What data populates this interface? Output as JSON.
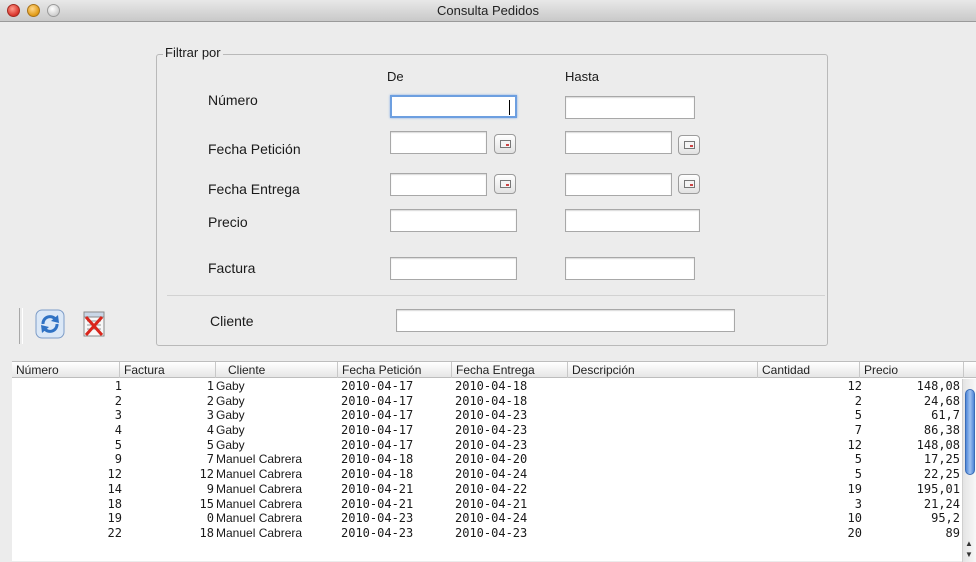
{
  "window": {
    "title": "Consulta Pedidos"
  },
  "filter": {
    "legend": "Filtrar por",
    "col_from": "De",
    "col_to": "Hasta",
    "labels": {
      "numero": "Número",
      "fecha_peticion": "Fecha Petición",
      "fecha_entrega": "Fecha Entrega",
      "precio": "Precio",
      "factura": "Factura",
      "cliente": "Cliente"
    },
    "values": {
      "numero_de": "",
      "numero_hasta": "",
      "fecha_peticion_de": "",
      "fecha_peticion_hasta": "",
      "fecha_entrega_de": "",
      "fecha_entrega_hasta": "",
      "precio_de": "",
      "precio_hasta": "",
      "factura_de": "",
      "factura_hasta": "",
      "cliente": ""
    }
  },
  "toolbar": {
    "icons": [
      "refresh-icon",
      "clear-filter-icon"
    ]
  },
  "table": {
    "columns": [
      "Número",
      "Factura",
      "Cliente",
      "Fecha Petición",
      "Fecha Entrega",
      "Descripción",
      "Cantidad",
      "Precio"
    ],
    "rows": [
      [
        "1",
        "1",
        "Gaby",
        "2010-04-17",
        "2010-04-18",
        "",
        "12",
        "148,08"
      ],
      [
        "2",
        "2",
        "Gaby",
        "2010-04-17",
        "2010-04-18",
        "",
        "2",
        "24,68"
      ],
      [
        "3",
        "3",
        "Gaby",
        "2010-04-17",
        "2010-04-23",
        "",
        "5",
        "61,7"
      ],
      [
        "4",
        "4",
        "Gaby",
        "2010-04-17",
        "2010-04-23",
        "",
        "7",
        "86,38"
      ],
      [
        "5",
        "5",
        "Gaby",
        "2010-04-17",
        "2010-04-23",
        "",
        "12",
        "148,08"
      ],
      [
        "9",
        "7",
        "Manuel Cabrera",
        "2010-04-18",
        "2010-04-20",
        "",
        "5",
        "17,25"
      ],
      [
        "12",
        "12",
        "Manuel Cabrera",
        "2010-04-18",
        "2010-04-24",
        "",
        "5",
        "22,25"
      ],
      [
        "14",
        "9",
        "Manuel Cabrera",
        "2010-04-21",
        "2010-04-22",
        "",
        "19",
        "195,01"
      ],
      [
        "18",
        "15",
        "Manuel Cabrera",
        "2010-04-21",
        "2010-04-21",
        "",
        "3",
        "21,24"
      ],
      [
        "19",
        "0",
        "Manuel Cabrera",
        "2010-04-23",
        "2010-04-24",
        "",
        "10",
        "95,2"
      ],
      [
        "22",
        "18",
        "Manuel Cabrera",
        "2010-04-23",
        "2010-04-23",
        "",
        "20",
        "89"
      ]
    ]
  },
  "colors": {
    "focus": "#6d9fe0",
    "scroll_thumb": "#4f86d8"
  }
}
